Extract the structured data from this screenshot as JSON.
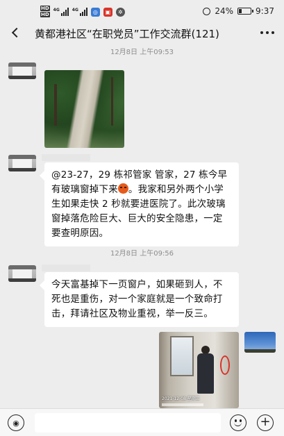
{
  "status_bar": {
    "hd_labels": [
      "HD",
      "HD"
    ],
    "signal_tags": [
      "4G",
      "4G"
    ],
    "battery_percent": "24%",
    "battery_level": 0.24,
    "time": "9:37",
    "icons": [
      "hd-icon",
      "signal-icon",
      "signal-icon",
      "app-notification-icon",
      "app-notification-icon",
      "app-notification-icon",
      "alarm-icon",
      "battery-icon"
    ]
  },
  "header": {
    "title": "黄都港社区“在职党员”工作交流群(121)",
    "back_icon": "back-chevron-icon",
    "more_icon": "more-dots-icon"
  },
  "messages": [
    {
      "timestamp": "12月8日 上午09:53",
      "type": "image",
      "image_desc": "photo-path"
    },
    {
      "type": "text",
      "text_before_emoji": "@23-27，29 栋祁管家  管家，27 栋今早有玻璃窗掉下来",
      "text_after_emoji": "。我家和另外两个小学生如果走快 2 秒就要进医院了。此次玻璃窗掉落危险巨大、巨大的安全隐患，一定要查明原因。"
    },
    {
      "timestamp": "12月8日 上午09:56",
      "type": "text",
      "text": "今天富基掉下一页窗户，如果砸到人，不死也是重伤，对一个家庭就是一个致命打击，拜请社区及物业重视，举一反三。"
    }
  ],
  "photo_caption": "2021-12-08  星期三",
  "input_bar": {
    "voice_icon": "voice-icon",
    "emoji_icon": "emoji-icon",
    "plus_icon": "plus-icon"
  },
  "colors": {
    "background": "#ededed",
    "bubble": "#ffffff",
    "timestamp": "#8c8c8c",
    "emoji": "#e65a1c"
  }
}
